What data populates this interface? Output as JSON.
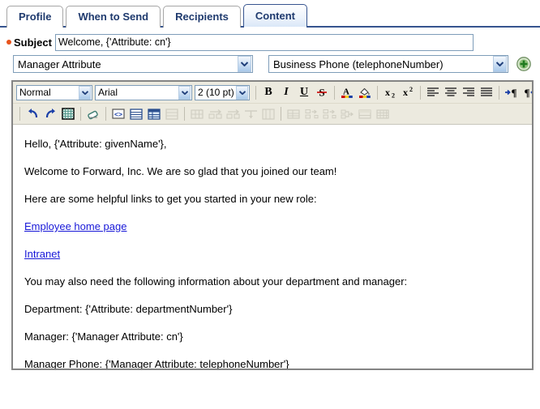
{
  "tabs": [
    {
      "label": "Profile",
      "active": false
    },
    {
      "label": "When to Send",
      "active": false
    },
    {
      "label": "Recipients",
      "active": false
    },
    {
      "label": "Content",
      "active": true
    }
  ],
  "subject": {
    "label": "Subject",
    "required_marker": "required-dot",
    "value": "Welcome, {'Attribute: cn'}"
  },
  "attribute_picker": {
    "source_select": {
      "value": "Manager Attribute",
      "icon": "chevron-down-icon"
    },
    "field_select": {
      "value": "Business Phone (telephoneNumber)",
      "icon": "chevron-down-icon"
    },
    "add_button": {
      "icon": "green-plus-icon",
      "label": "Add"
    }
  },
  "editor": {
    "toolbar": {
      "paragraph_style": {
        "value": "Normal",
        "icon": "chevron-down-icon"
      },
      "font_family": {
        "value": "Arial",
        "icon": "chevron-down-icon"
      },
      "font_size": {
        "value": "2 (10 pt)",
        "icon": "chevron-down-icon"
      },
      "row1_buttons": [
        {
          "name": "bold-button",
          "glyph": "B",
          "disabled": false
        },
        {
          "name": "italic-button",
          "glyph": "I",
          "disabled": false
        },
        {
          "name": "underline-button",
          "glyph": "U",
          "disabled": false
        },
        {
          "name": "strikethrough-button",
          "glyph": "S",
          "disabled": false
        },
        {
          "name": "font-color-button",
          "glyph": "",
          "disabled": false
        },
        {
          "name": "highlight-color-button",
          "glyph": "",
          "disabled": false
        },
        {
          "name": "subscript-button",
          "glyph": "x",
          "disabled": false
        },
        {
          "name": "superscript-button",
          "glyph": "x",
          "disabled": false
        },
        {
          "name": "align-left-button",
          "glyph": "",
          "disabled": false
        },
        {
          "name": "align-center-button",
          "glyph": "",
          "disabled": false
        },
        {
          "name": "align-right-button",
          "glyph": "",
          "disabled": false
        },
        {
          "name": "align-justify-button",
          "glyph": "",
          "disabled": false
        },
        {
          "name": "text-direction-ltr-button",
          "glyph": "",
          "disabled": false
        },
        {
          "name": "text-direction-rtl-button",
          "glyph": "",
          "disabled": false
        },
        {
          "name": "numbered-list-button",
          "glyph": "",
          "disabled": false
        }
      ],
      "row2_buttons": [
        {
          "name": "undo-button",
          "disabled": false
        },
        {
          "name": "redo-button",
          "disabled": false
        },
        {
          "name": "show-grid-button",
          "disabled": false
        },
        {
          "name": "erase-formatting-button",
          "disabled": false
        },
        {
          "name": "source-code-button",
          "disabled": false
        },
        {
          "name": "insert-table-button",
          "disabled": false
        },
        {
          "name": "table-properties-button",
          "disabled": false
        },
        {
          "name": "delete-table-button",
          "disabled": true
        },
        {
          "name": "cell-properties-button",
          "disabled": true
        },
        {
          "name": "insert-row-button",
          "disabled": true
        },
        {
          "name": "insert-column-button",
          "disabled": true
        },
        {
          "name": "merge-cells-button",
          "disabled": true
        },
        {
          "name": "split-cell-button",
          "disabled": true
        },
        {
          "name": "row-properties-button",
          "disabled": true
        },
        {
          "name": "delete-row-button",
          "disabled": true
        },
        {
          "name": "delete-column-button",
          "disabled": true
        },
        {
          "name": "split-column-button",
          "disabled": true
        },
        {
          "name": "table-grid-button",
          "disabled": true
        },
        {
          "name": "table-header-button",
          "disabled": true
        },
        {
          "name": "delete-cell-button",
          "disabled": true
        },
        {
          "name": "merge-right-button",
          "disabled": true
        },
        {
          "name": "merge-down-button",
          "disabled": true
        },
        {
          "name": "split-horizontal-button",
          "disabled": true
        },
        {
          "name": "table-row-button",
          "disabled": true
        },
        {
          "name": "table-cell-button",
          "disabled": true
        }
      ]
    },
    "body": [
      {
        "type": "text",
        "text": "Hello, {'Attribute: givenName'},"
      },
      {
        "type": "text",
        "text": "Welcome to Forward, Inc. We are so glad that you joined our team!"
      },
      {
        "type": "text",
        "text": "Here are some helpful links to get you started in your new role:"
      },
      {
        "type": "link",
        "text": "Employee home page"
      },
      {
        "type": "link",
        "text": "Intranet"
      },
      {
        "type": "text",
        "text": "You may also need the following information about your department and manager:"
      },
      {
        "type": "text",
        "text": "Department: {'Attribute: departmentNumber'}"
      },
      {
        "type": "text",
        "text": "Manager: {'Manager Attribute: cn'}"
      },
      {
        "type": "text",
        "text": "Manager Phone: {'Manager Attribute: telephoneNumber'}"
      }
    ]
  },
  "colors": {
    "tab_active_border": "#36548f",
    "tab_text": "#1f3a6e",
    "required_marker": "#e8531b",
    "link": "#1818d8",
    "toolbar_bg": "#eceadf",
    "editor_border": "#848484",
    "input_border": "#7f9db9",
    "add_button": "#3f9a3f"
  }
}
